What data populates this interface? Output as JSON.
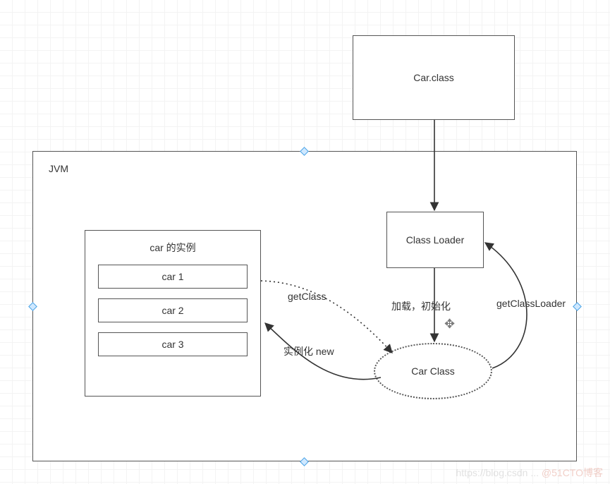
{
  "carClassFile": {
    "label": "Car.class"
  },
  "jvm": {
    "label": "JVM"
  },
  "classLoader": {
    "label": "Class Loader"
  },
  "carClassEllipse": {
    "label": "Car Class"
  },
  "instances": {
    "title": "car 的实例",
    "items": [
      "car 1",
      "car 2",
      "car 3"
    ]
  },
  "edges": {
    "getClass": "getClass",
    "loadInit": "加载，初始化",
    "getClassLoader": "getClassLoader",
    "instantiate": "实例化 new"
  },
  "watermark": {
    "prefix": "https://blog.csdn ... ",
    "brand": "@51CTO博客"
  }
}
